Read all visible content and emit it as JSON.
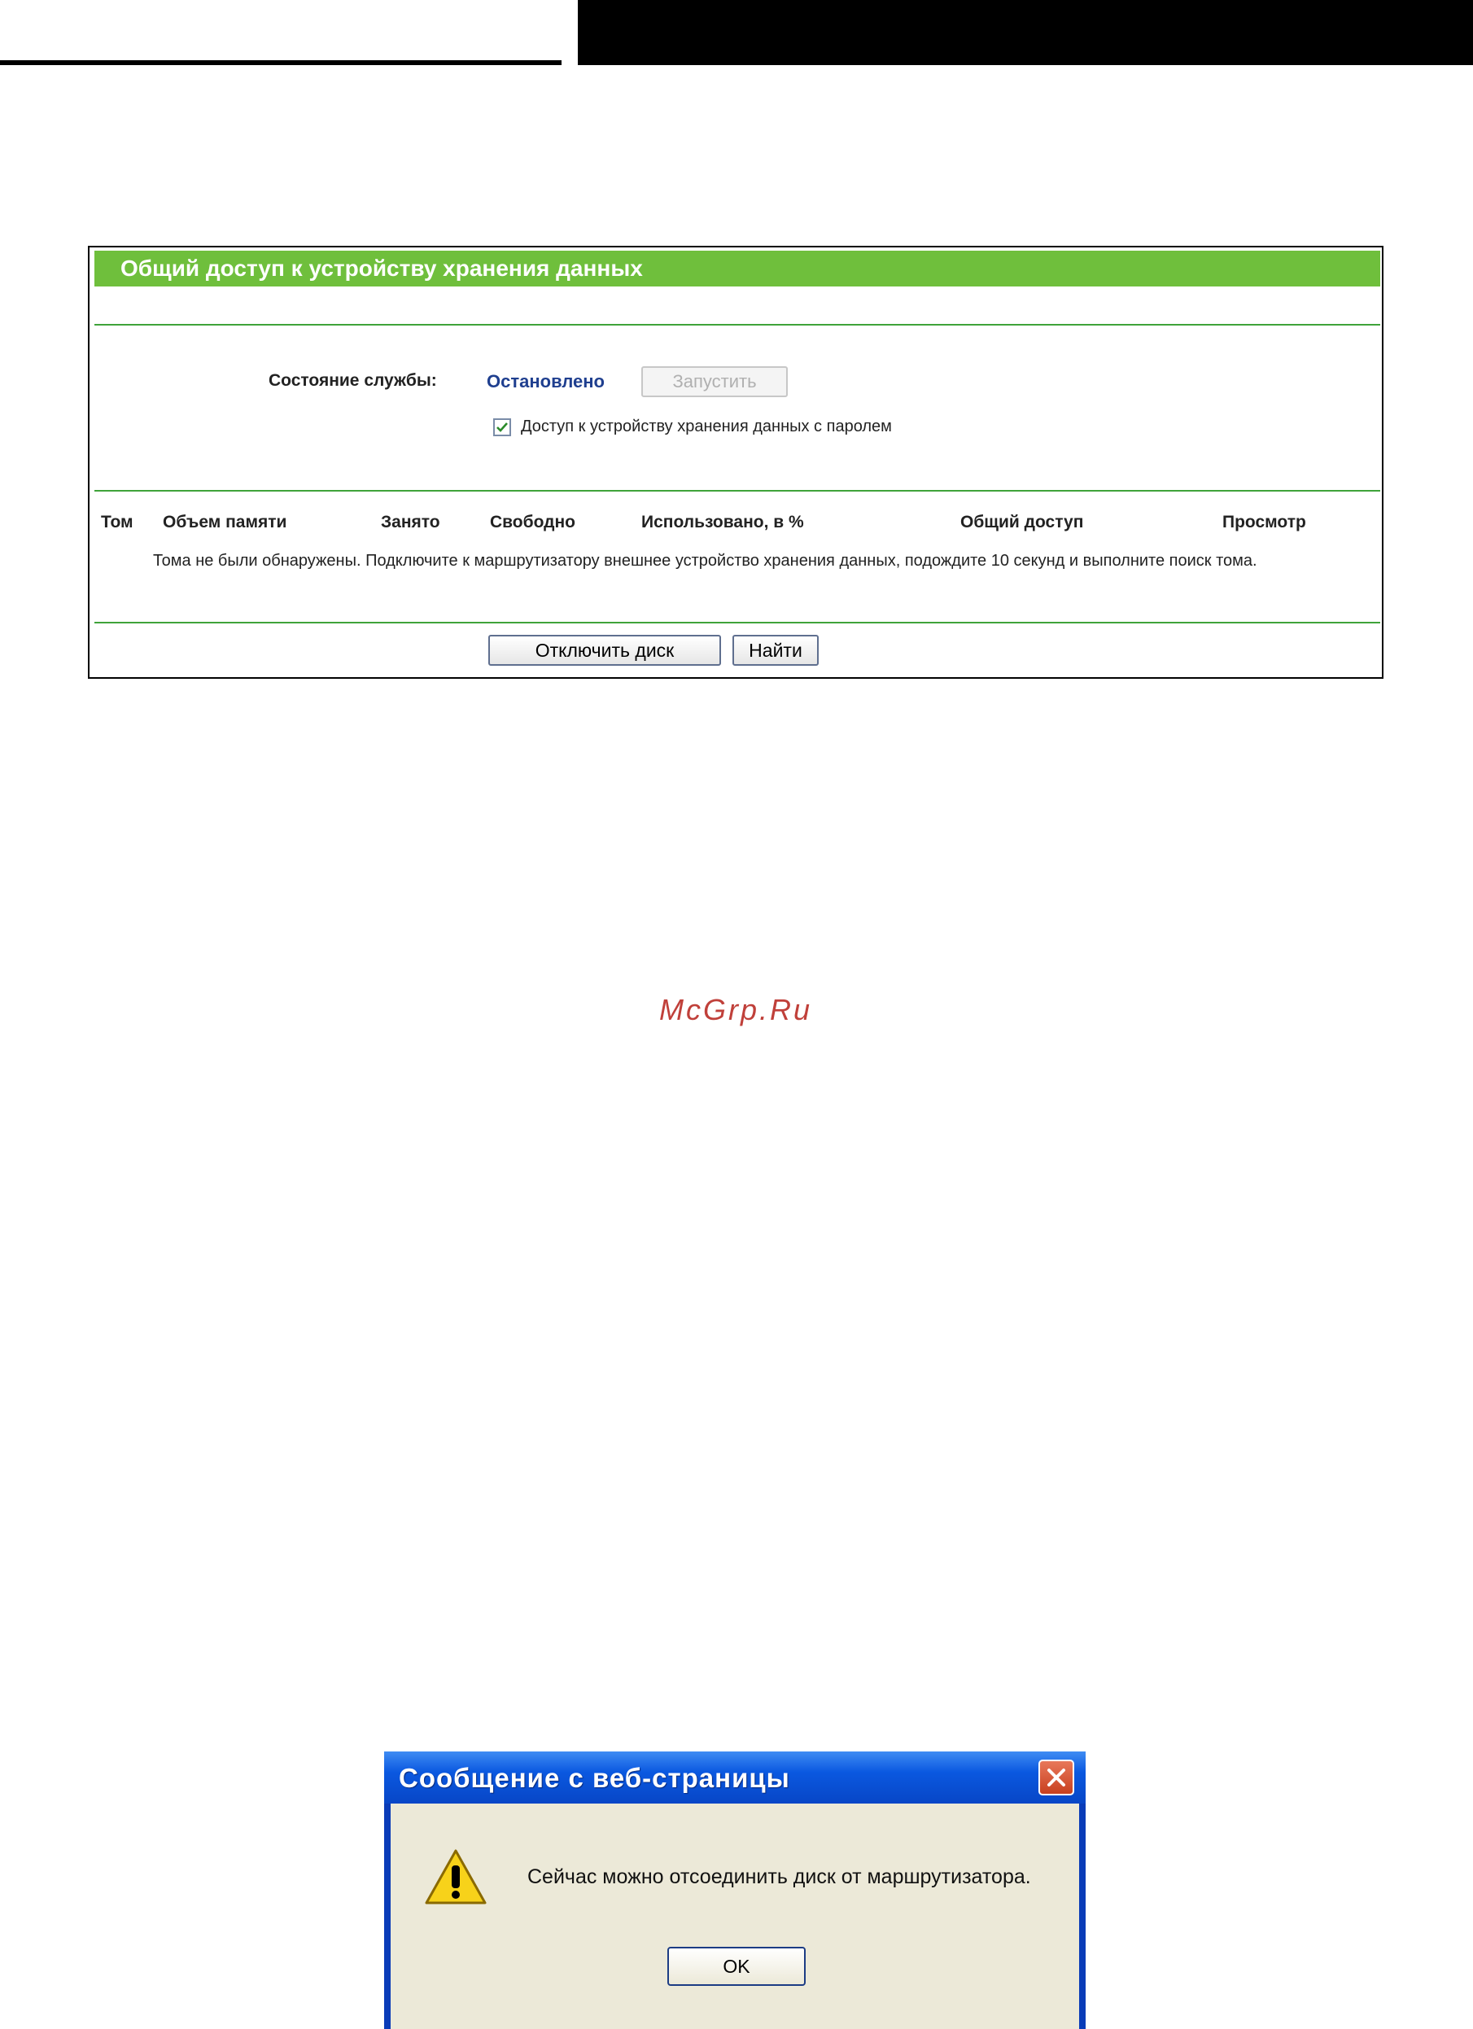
{
  "panel": {
    "title": "Общий доступ к устройству хранения данных",
    "status_label": "Состояние службы:",
    "status_value": "Остановлено",
    "start_button": "Запустить",
    "password_checkbox_label": "Доступ к устройству хранения данных с паролем",
    "password_checkbox_checked": true,
    "table_headers": [
      "Том",
      "Объем памяти",
      "Занято",
      "Свободно",
      "Использовано, в %",
      "Общий доступ",
      "Просмотр"
    ],
    "empty_message": "Тома не были обнаружены. Подключите к маршрутизатору внешнее устройство хранения данных, подождите 10 секунд и выполните поиск тома.",
    "disconnect_button": "Отключить диск",
    "find_button": "Найти",
    "header_color": "#6fbf3c",
    "status_color": "#1f3f8f"
  },
  "watermark": "McGrp.Ru",
  "dialog": {
    "title": "Сообщение с веб-страницы",
    "message": "Сейчас можно отсоединить диск от маршрутизатора.",
    "ok_button": "OK",
    "icon": "warning-icon"
  }
}
